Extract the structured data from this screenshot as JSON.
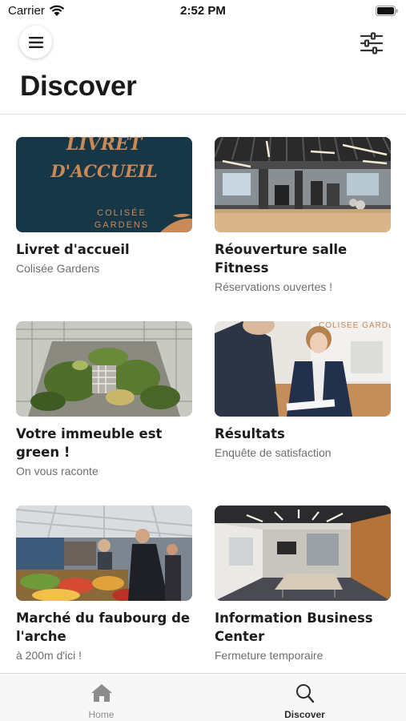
{
  "status_bar": {
    "carrier": "Carrier",
    "time": "2:52 PM"
  },
  "header": {
    "title": "Discover",
    "menu_icon": "hamburger-menu-icon",
    "filter_icon": "sliders-icon"
  },
  "cards": [
    {
      "title": "Livret d'accueil",
      "subtitle": "Colisée Gardens",
      "image_text": [
        "LIVRET",
        "D'ACCUEIL"
      ],
      "image_brand": [
        "COLISÉE",
        "GARDENS"
      ]
    },
    {
      "title": "Réouverture salle Fitness",
      "subtitle": "Réservations ouvertes !"
    },
    {
      "title": "Votre immeuble est green !",
      "subtitle": "On vous raconte"
    },
    {
      "title": "Résultats",
      "subtitle": "Enquête de satisfaction",
      "image_sign": "COLISÉE GARDENS"
    },
    {
      "title": "Marché du faubourg de l'arche",
      "subtitle": "à 200m d'ici !"
    },
    {
      "title": "Information Business Center",
      "subtitle": "Fermeture temporaire"
    }
  ],
  "tab_bar": {
    "tabs": [
      {
        "label": "Home",
        "icon": "home-icon",
        "active": false
      },
      {
        "label": "Discover",
        "icon": "search-icon",
        "active": true
      }
    ]
  },
  "colors": {
    "booklet_bg": "#173747",
    "booklet_text": "#c98a58",
    "active_tab": "#2a2a2a",
    "inactive_tab": "#8c8c8c"
  }
}
